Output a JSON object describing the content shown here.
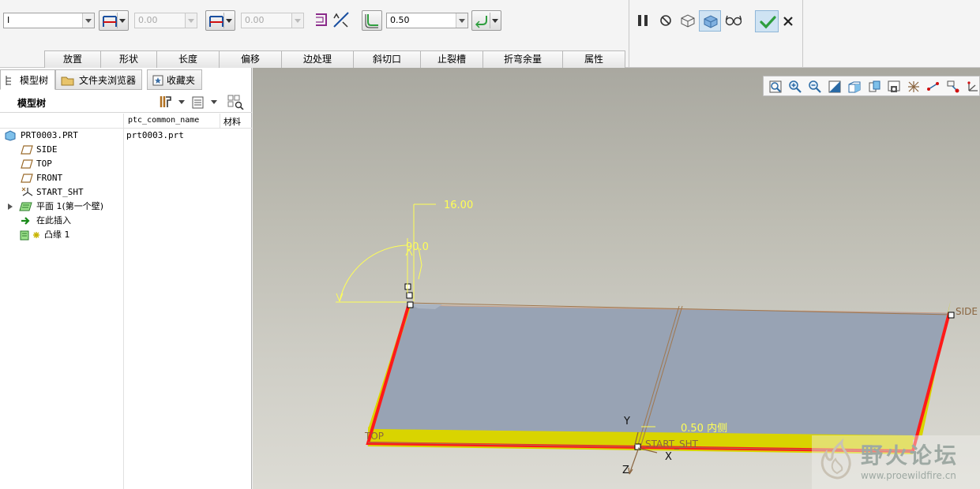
{
  "dashboard": {
    "type_combo": "I",
    "length_value_1": "0.00",
    "length_value_2": "0.00",
    "thickness_value": "0.50",
    "tabs": [
      "放置",
      "形状",
      "长度",
      "偏移",
      "边处理",
      "斜切口",
      "止裂槽",
      "折弯余量",
      "属性"
    ]
  },
  "left_panel": {
    "tabs": [
      "模型树",
      "文件夹浏览器",
      "收藏夹"
    ],
    "header_title": "模型树",
    "columns": [
      "ptc_common_name",
      "材料"
    ],
    "tree": [
      {
        "label": "PRT0003.PRT",
        "value": "prt0003.prt",
        "icon": "part-icon"
      },
      {
        "label": "SIDE",
        "icon": "datum-plane-icon"
      },
      {
        "label": "TOP",
        "icon": "datum-plane-icon"
      },
      {
        "label": "FRONT",
        "icon": "datum-plane-icon"
      },
      {
        "label": "START_SHT",
        "icon": "coordinate-system-icon"
      },
      {
        "label": "平面 1(第一个壁)",
        "icon": "flat-wall-icon"
      },
      {
        "label": "在此插入",
        "icon": "insert-here-arrow-icon"
      },
      {
        "label": "凸缘 1",
        "icon": "flange-icon"
      }
    ]
  },
  "viewport": {
    "dim_length": "16.00",
    "dim_angle": "90.0",
    "dim_thickness": "0.50 内侧",
    "plane_side": "SIDE",
    "plane_top": "TOP",
    "csys_name": "START_SHT",
    "axis_x": "X",
    "axis_y": "Y",
    "axis_z": "Z"
  },
  "watermark": {
    "name": "野火论坛",
    "url": "www.proewildfire.cn"
  },
  "colors": {
    "accent_green": "#2e9e3e",
    "edge_red": "#ff1a1a",
    "flange_yellow": "#d9d400",
    "sheet_gray": "#98a3b4"
  }
}
